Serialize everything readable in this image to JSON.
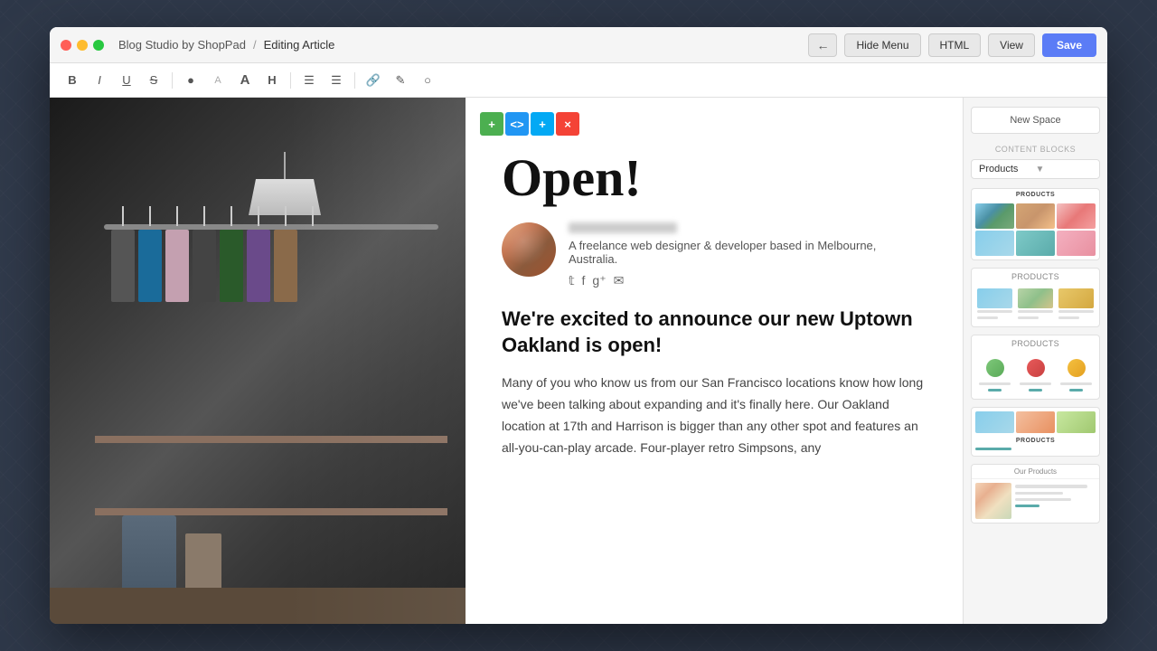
{
  "window": {
    "title": "Blog Studio by ShopPad",
    "breadcrumb_sep": "/",
    "editing_label": "Editing Article"
  },
  "titlebar": {
    "app_name": "Blog Studio by ShopPad",
    "separator": "/",
    "current_page": "Editing Article",
    "back_arrow": "←",
    "hide_menu_label": "Hide Menu",
    "html_label": "HTML",
    "view_label": "View",
    "save_label": "Save"
  },
  "toolbar": {
    "bold": "B",
    "italic": "I",
    "underline": "U",
    "strikethrough": "S",
    "highlight": "●",
    "font_size": "A",
    "font": "A",
    "heading": "H",
    "align_left": "≡",
    "align_right": "≡",
    "link": "⛓",
    "pencil": "✎",
    "circle": "○"
  },
  "editor": {
    "action_bar": {
      "add": "+",
      "code": "<>",
      "plus2": "+",
      "close": "×"
    },
    "article_title": "Open!",
    "author_bio": "A freelance web designer & developer based in Melbourne, Australia.",
    "social_twitter": "𝕥",
    "social_facebook": "f",
    "social_gplus": "g+",
    "social_email": "✉",
    "article_heading": "We're excited to announce our new Uptown Oakland is open!",
    "article_body": "Many of you who know us from our San Francisco locations know how long we've been talking about expanding and it's finally here. Our Oakland location at 17th and Harrison is bigger than any other spot and features an all-you-can-play arcade. Four-player retro Simpsons, any"
  },
  "sidebar": {
    "new_space_label": "New Space",
    "content_blocks_label": "CONTENT BLOCKS",
    "filter_label": "Products",
    "blocks": [
      {
        "id": 1,
        "label": "PRODUCTS",
        "type": "grid-three"
      },
      {
        "id": 2,
        "label": "Products",
        "type": "grid-three-lines"
      },
      {
        "id": 3,
        "label": "Products",
        "type": "circles-three"
      },
      {
        "id": 4,
        "label": "PRODUCTS",
        "type": "landscape-lines"
      },
      {
        "id": 5,
        "label": "Our Products",
        "type": "product-detail"
      }
    ]
  },
  "colors": {
    "save_btn": "#5b7cf6",
    "action_green": "#4caf50",
    "action_blue": "#2196f3",
    "action_lightblue": "#03a9f4",
    "action_red": "#f44336"
  }
}
